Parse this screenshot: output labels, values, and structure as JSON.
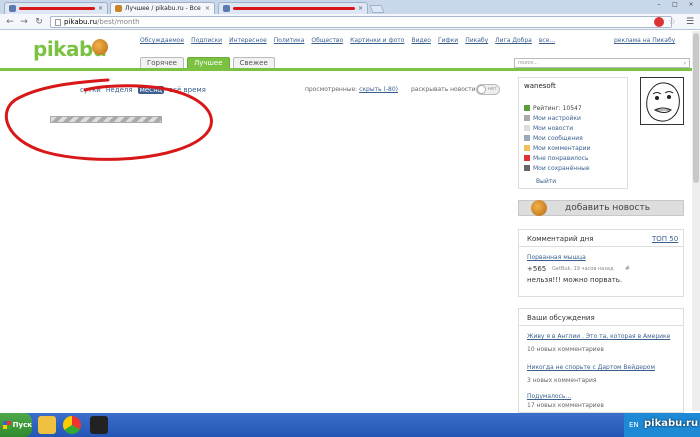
{
  "browser": {
    "tabs": [
      {
        "label": "",
        "redacted": true
      },
      {
        "label": "Лучшее / pikabu.ru - Все"
      },
      {
        "label": "",
        "redacted": true
      }
    ],
    "tab_close": "×",
    "window_buttons": [
      "–",
      "□",
      "×"
    ],
    "url_host": "pikabu.ru",
    "url_path": "/best/month",
    "nav": {
      "back": "←",
      "forward": "→",
      "reload": "↻"
    },
    "star": "☆",
    "wrench": "🔧"
  },
  "site": {
    "logo": "pikabu",
    "nav_links": [
      "Обсуждаемое",
      "Подписки",
      "Интересное",
      "Политика",
      "Общество",
      "Картинки и фото",
      "Видео",
      "Гифки",
      "Пикабу",
      "Лига Добра",
      "все..."
    ],
    "ad_link": "реклама на Пикабу",
    "filter_tabs": [
      {
        "label": "Горячее",
        "active": false
      },
      {
        "label": "Лучшее",
        "active": true
      },
      {
        "label": "Свежее",
        "active": false
      }
    ],
    "search_placeholder": "поиск...",
    "search_go": "›"
  },
  "toolbar": {
    "periods": [
      {
        "label": "сутки",
        "current": false
      },
      {
        "label": "неделя",
        "current": false
      },
      {
        "label": "месяц",
        "current": true
      },
      {
        "label": "всё время",
        "current": false
      }
    ],
    "viewed_label": "просмотренные:",
    "viewed_link": "скрыть (-80)",
    "expand_label": "раскрывать новости",
    "toggle_label": "нет",
    "toggle_on": false
  },
  "user": {
    "name": "wanesoft",
    "links": [
      {
        "label": "Рейтинг: 10547",
        "icon": "rating-icon",
        "color": "#5b9f3a",
        "plain": true
      },
      {
        "label": "Мои настройки",
        "icon": "settings-icon",
        "color": "#aaaaaa"
      },
      {
        "label": "Мои новости",
        "icon": "news-icon",
        "color": "#dddddd"
      },
      {
        "label": "Мои сообщения",
        "icon": "messages-icon",
        "color": "#9ab"
      },
      {
        "label": "Мои комментарии",
        "icon": "comments-icon",
        "color": "#f0c060"
      },
      {
        "label": "Мне понравилось",
        "icon": "heart-icon",
        "color": "#d33"
      },
      {
        "label": "Мои сохранённые",
        "icon": "saved-icon",
        "color": "#666"
      }
    ],
    "logout": "Выйти"
  },
  "add_news": "добавить новость",
  "comment_of_day": {
    "title": "Комментарий дня",
    "top_link": "ТОП 50",
    "post_link": "Порванная мышца",
    "score": "+565",
    "meta": "GetBuk, 19 часов назад",
    "hash": "#",
    "text": "нельзя!!! можно порвать."
  },
  "discussions": {
    "title": "Ваши обсуждения",
    "items": [
      {
        "link": "Живу я в Англии . Это та, которая в Америке",
        "count": "10 новых комментариев"
      },
      {
        "link": "Никогда не спорьте с Дартом Вейдером",
        "count": "3 новых комментария"
      },
      {
        "link": "Подумалось...",
        "count": "17 новых комментариев"
      }
    ]
  },
  "taskbar": {
    "start": "Пуск",
    "lang": "EN",
    "watermark": "pikabu.ru"
  },
  "colors": {
    "accent_green": "#7bc142",
    "link_blue": "#3a5f8f",
    "annotation_red": "#d81818"
  },
  "loading_progress": 1.0
}
